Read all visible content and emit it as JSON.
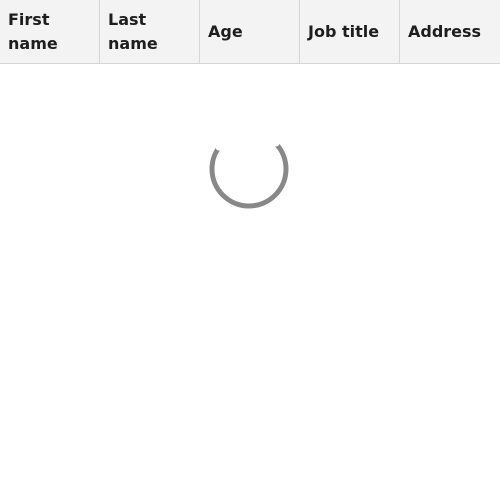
{
  "table": {
    "columns": [
      {
        "label": "First name"
      },
      {
        "label": "Last name"
      },
      {
        "label": "Age"
      },
      {
        "label": "Job title"
      },
      {
        "label": "Address"
      }
    ]
  },
  "loading": {
    "icon": "loading-spinner-icon",
    "track_color": "#888888",
    "highlight_color": "#ffffff"
  }
}
